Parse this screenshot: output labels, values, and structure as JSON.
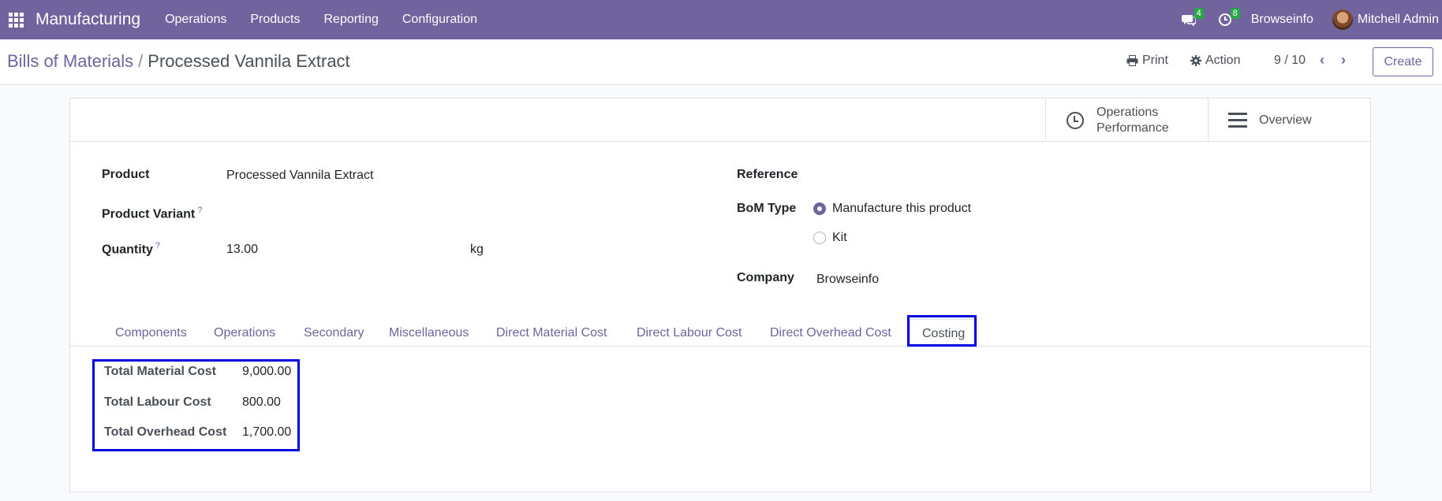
{
  "navbar": {
    "app_name": "Manufacturing",
    "menu": [
      "Operations",
      "Products",
      "Reporting",
      "Configuration"
    ],
    "messages_count": "4",
    "activities_count": "8",
    "company": "Browseinfo",
    "user": "Mitchell Admin",
    "color": "#71639e"
  },
  "control_panel": {
    "breadcrumb_parent": "Bills of Materials",
    "breadcrumb_separator": "/",
    "breadcrumb_current": "Processed Vannila Extract",
    "print_label": "Print",
    "action_label": "Action",
    "pager": "9 / 10",
    "create_label": "Create"
  },
  "smart_buttons": {
    "operations_performance_line1": "Operations",
    "operations_performance_line2": "Performance",
    "overview": "Overview"
  },
  "form": {
    "product_label": "Product",
    "product_value": "Processed Vannila Extract",
    "variant_label": "Product Variant",
    "quantity_label": "Quantity",
    "quantity_value": "13.00",
    "uom": "kg",
    "help_mark": "?",
    "reference_label": "Reference",
    "bom_type_label": "BoM Type",
    "bom_type_options": [
      "Manufacture this product",
      "Kit"
    ],
    "bom_type_selected": "Manufacture this product",
    "company_label": "Company",
    "company_value": "Browseinfo"
  },
  "tabs": [
    "Components",
    "Operations",
    "Secondary",
    "Miscellaneous",
    "Direct Material Cost",
    "Direct Labour Cost",
    "Direct Overhead Cost",
    "Costing"
  ],
  "active_tab": "Costing",
  "costing": [
    {
      "label": "Total Material Cost",
      "value": "9,000.00"
    },
    {
      "label": "Total Labour Cost",
      "value": "800.00"
    },
    {
      "label": "Total Overhead Cost",
      "value": "1,700.00"
    }
  ],
  "highlight_color": "#0000e0"
}
